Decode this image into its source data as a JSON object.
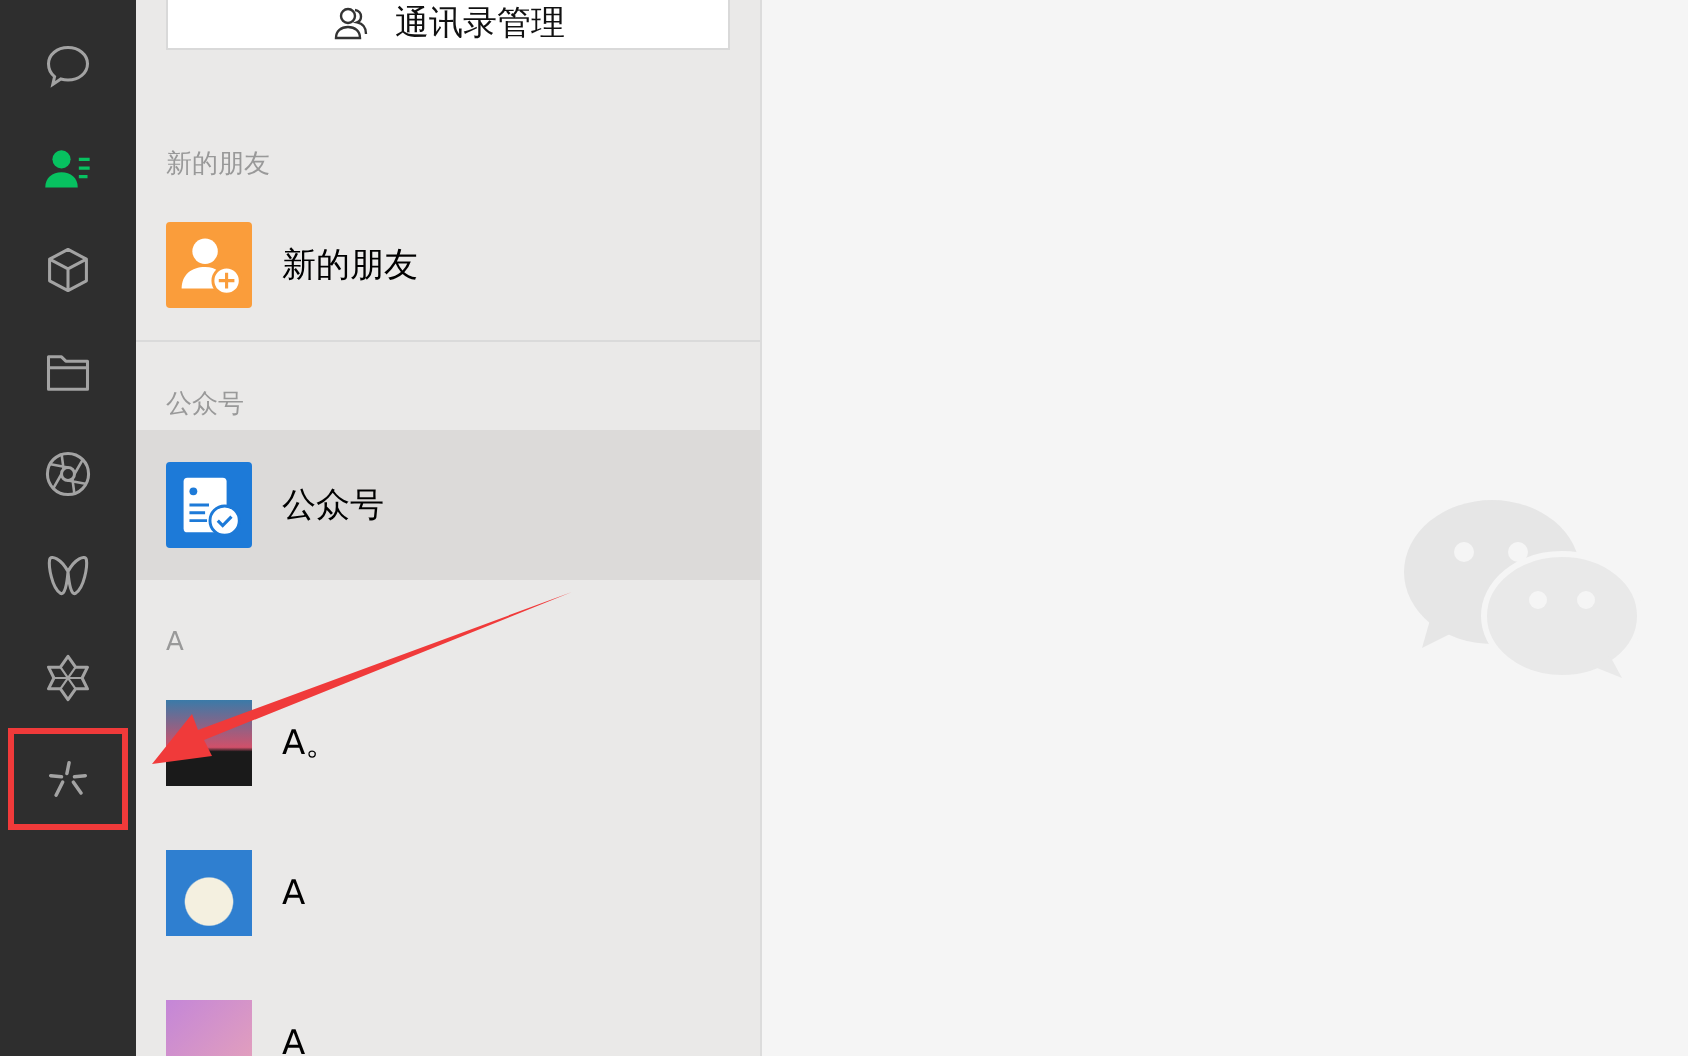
{
  "sidebar": {
    "items": [
      {
        "kind": "chat",
        "selected": false,
        "highlighted": false
      },
      {
        "kind": "contacts",
        "selected": true,
        "highlighted": false
      },
      {
        "kind": "cube",
        "selected": false,
        "highlighted": false
      },
      {
        "kind": "folder",
        "selected": false,
        "highlighted": false
      },
      {
        "kind": "aperture",
        "selected": false,
        "highlighted": false
      },
      {
        "kind": "butterfly",
        "selected": false,
        "highlighted": false
      },
      {
        "kind": "hexagram",
        "selected": false,
        "highlighted": false
      },
      {
        "kind": "spark",
        "selected": false,
        "highlighted": true
      }
    ]
  },
  "contacts_manage_button": "通讯录管理",
  "sections": [
    {
      "header": "新的朋友",
      "items": [
        {
          "name": "新的朋友",
          "kind": "new-friend",
          "selected": false
        }
      ]
    },
    {
      "header": "公众号",
      "items": [
        {
          "name": "公众号",
          "kind": "official-account",
          "selected": true
        }
      ]
    },
    {
      "header": "A",
      "items": [
        {
          "name": "A。",
          "kind": "photo",
          "selected": false
        },
        {
          "name": "A",
          "kind": "photo",
          "selected": false
        },
        {
          "name": "A",
          "kind": "photo",
          "selected": false
        }
      ]
    }
  ]
}
